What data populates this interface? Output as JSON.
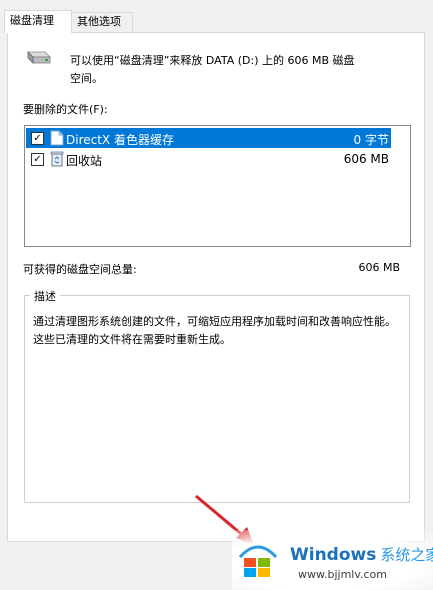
{
  "tabs": [
    {
      "label": "磁盘清理",
      "active": true
    },
    {
      "label": "其他选项",
      "active": false
    }
  ],
  "header": {
    "drive_icon": "drive-icon",
    "message": "可以使用“磁盘清理”来释放 DATA (D:) 上的 606 MB 磁盘空间。"
  },
  "files_label": "要删除的文件(F):",
  "files": [
    {
      "name": "DirectX 着色器缓存",
      "size": "0 字节",
      "checked": true,
      "selected": true,
      "icon": "file-icon"
    },
    {
      "name": "回收站",
      "size": "606 MB",
      "checked": true,
      "selected": false,
      "icon": "recycle-bin-icon"
    }
  ],
  "total": {
    "label": "可获得的磁盘空间总量:",
    "value": "606 MB"
  },
  "description": {
    "title": "描述",
    "text": "通过清理图形系统创建的文件，可缩短应用程序加载时间和改善响应性能。这些已清理的文件将在需要时重新生成。"
  },
  "watermark": {
    "brand": "Windows",
    "brand_cn": "系统之家",
    "url": "www.bjjmlv.com"
  },
  "colors": {
    "selection": "#0078d7",
    "brand_blue": "#1b72b8",
    "arrow_red": "#d9252a"
  }
}
